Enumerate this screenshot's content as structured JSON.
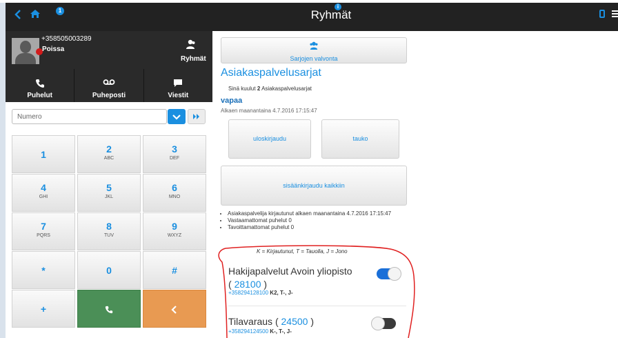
{
  "topbar": {
    "title": "Ryhmät",
    "info_badge": "i",
    "back_icon": "chevron-left-icon",
    "home_icon": "home-icon",
    "device_icon": "mobile-icon",
    "menu_icon": "hamburger-icon",
    "bar_color": "#222222"
  },
  "user": {
    "phone": "+358505003289",
    "status": "Poissa",
    "status_color": "#d11b1b",
    "groups_label": "Ryhmät"
  },
  "nav": {
    "tabs": [
      {
        "label": "Puhelut",
        "icon": "phone-icon",
        "badge": "1"
      },
      {
        "label": "Puheposti",
        "icon": "voicemail-icon"
      },
      {
        "label": "Viestit",
        "icon": "message-icon"
      }
    ]
  },
  "dialer": {
    "placeholder": "Numero",
    "keys": [
      {
        "digit": "1",
        "letters": ""
      },
      {
        "digit": "2",
        "letters": "ABC"
      },
      {
        "digit": "3",
        "letters": "DEF"
      },
      {
        "digit": "4",
        "letters": "GHI"
      },
      {
        "digit": "5",
        "letters": "JKL"
      },
      {
        "digit": "6",
        "letters": "MNO"
      },
      {
        "digit": "7",
        "letters": "PQRS"
      },
      {
        "digit": "8",
        "letters": "TUV"
      },
      {
        "digit": "9",
        "letters": "WXYZ"
      },
      {
        "digit": "*",
        "letters": ""
      },
      {
        "digit": "0",
        "letters": ""
      },
      {
        "digit": "#",
        "letters": ""
      },
      {
        "digit": "+",
        "letters": ""
      }
    ],
    "call_color": "#4b8f57",
    "backspace_color": "#e89a52"
  },
  "main": {
    "watch_button": "Sarjojen valvonta",
    "section_title": "Asiakaspalvelusarjat",
    "member_prefix": "Sinä kuulut",
    "member_count": "2",
    "member_suffix": "Asiakaspalvelusarjat",
    "status_word": "vapaa",
    "since": "Alkaen maanantaina 4.7.2016 17:15:47",
    "logout_button": "uloskirjaudu",
    "pause_button": "tauko",
    "login_all_button": "sisäänkirjaudu kaikkiin",
    "info": [
      "Asiakaspalvelija kirjautunut alkaen maanantaina 4.7.2016 17:15:47",
      "Vastaamattomat puhelut 0",
      "Tavoittamattomat puhelut 0"
    ],
    "legend": "K = Kirjautunut, T = Tauolla, J = Jono"
  },
  "queues": [
    {
      "name": "Hakijapalvelut Avoin yliopisto",
      "number": "28100",
      "phone": "+358294128100",
      "ktj": "K2, T-, J-",
      "enabled": true
    },
    {
      "name": "Tilavaraus",
      "number": "24500",
      "phone": "+358294124500",
      "ktj": "K-, T-, J-",
      "enabled": false
    }
  ],
  "colors": {
    "accent": "#1a8fe0",
    "annotation": "#e02020"
  }
}
